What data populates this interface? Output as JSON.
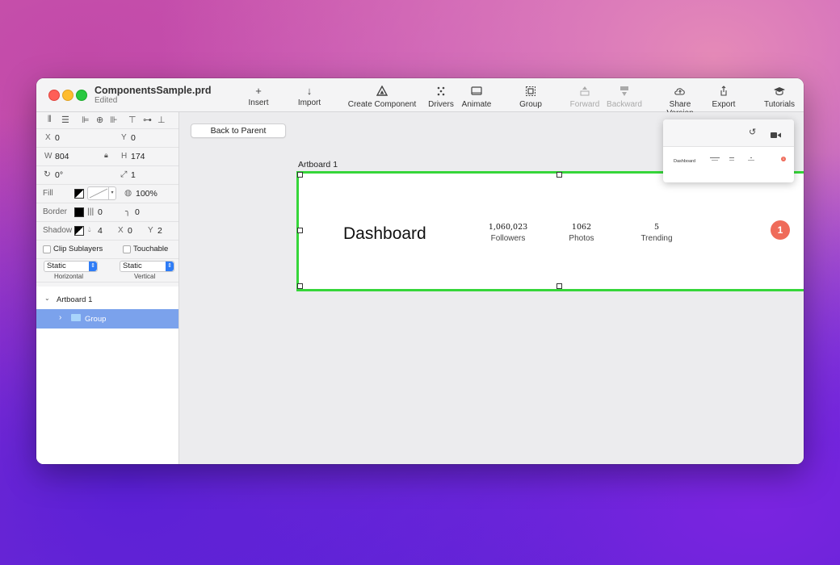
{
  "window": {
    "title": "ComponentsSample.prd",
    "subtitle": "Edited"
  },
  "toolbar": {
    "insert": "Insert",
    "import": "Import",
    "create_component": "Create Component",
    "drivers": "Drivers",
    "animate": "Animate",
    "group": "Group",
    "forward": "Forward",
    "backward": "Backward",
    "share_version": "Share Version",
    "export": "Export",
    "tutorials": "Tutorials"
  },
  "inspector": {
    "x_label": "X",
    "x_value": "0",
    "y_label": "Y",
    "y_value": "0",
    "w_label": "W",
    "w_value": "804",
    "h_label": "H",
    "h_value": "174",
    "rotation": "0°",
    "scale": "1",
    "fill_label": "Fill",
    "fill_opacity": "100%",
    "border_label": "Border",
    "border_width": "0",
    "border_radius": "0",
    "shadow_label": "Shadow",
    "shadow_blur": "4",
    "shadow_x_label": "X",
    "shadow_x": "0",
    "shadow_y_label": "Y",
    "shadow_y": "2",
    "clip_sublayers": "Clip Sublayers",
    "touchable": "Touchable",
    "horizontal_value": "Static",
    "horizontal_label": "Horizontal",
    "vertical_value": "Static",
    "vertical_label": "Vertical"
  },
  "layers": {
    "artboard": "Artboard 1",
    "group": "Group"
  },
  "canvas": {
    "back_button": "Back to Parent",
    "artboard_label": "Artboard 1",
    "dashboard_title": "Dashboard",
    "stats": [
      {
        "value": "1,060,023",
        "label": "Followers"
      },
      {
        "value": "1062",
        "label": "Photos"
      },
      {
        "value": "5",
        "label": "Trending"
      }
    ],
    "badge": "1"
  },
  "preview": {
    "title": "Dashboard",
    "badge": "1"
  },
  "colors": {
    "selection": "#36d63a",
    "badge": "#ef6b5a",
    "layer_selected": "#7ba2ec"
  }
}
